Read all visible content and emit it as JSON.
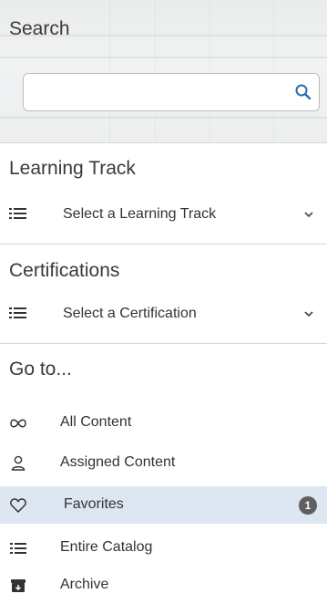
{
  "search": {
    "title": "Search",
    "placeholder": "",
    "value": ""
  },
  "learning_track": {
    "title": "Learning Track",
    "select_label": "Select a Learning Track"
  },
  "certifications": {
    "title": "Certifications",
    "select_label": "Select a Certification"
  },
  "goto": {
    "title": "Go to...",
    "items": [
      {
        "label": "All Content",
        "icon": "infinity-icon"
      },
      {
        "label": "Assigned Content",
        "icon": "user-icon"
      },
      {
        "label": "Favorites",
        "icon": "heart-icon",
        "badge": "1",
        "active": true
      },
      {
        "label": "Entire Catalog",
        "icon": "list-icon"
      },
      {
        "label": "Archive",
        "icon": "archive-icon"
      }
    ]
  },
  "colors": {
    "active_bg": "#dde6f1",
    "search_icon": "#2a6db0",
    "badge_bg": "#5f5f5f"
  }
}
